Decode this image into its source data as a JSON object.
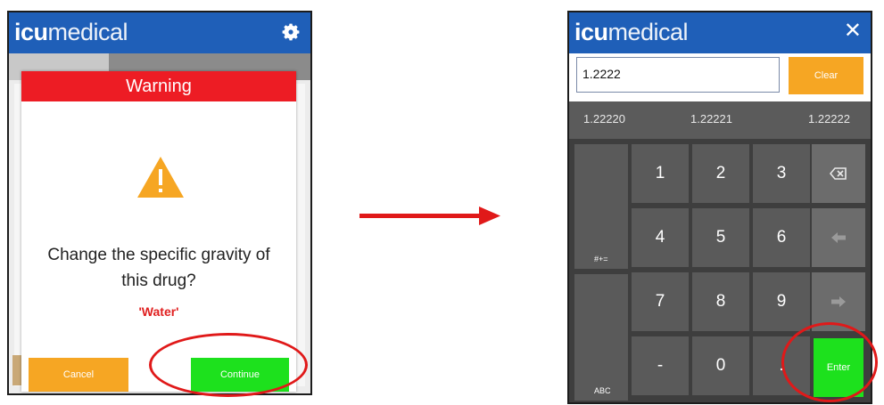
{
  "left_screen": {
    "logo_bold": "icu",
    "logo_light": "medical",
    "dialog": {
      "title": "Warning",
      "message_line1": "Change the specific gravity of",
      "message_line2": "this drug?",
      "drug_name": "'Water'",
      "cancel_label": "Cancel",
      "continue_label": "Continue"
    },
    "icons": {
      "settings": "gear-icon",
      "warning": "warning-triangle-icon"
    }
  },
  "arrow_icon": "right-arrow-icon",
  "right_screen": {
    "logo_bold": "icu",
    "logo_light": "medical",
    "close_glyph": "✕",
    "input_value": "1.2222",
    "clear_label": "Clear",
    "suggestions": [
      "1.22220",
      "1.22221",
      "1.22222"
    ],
    "keys": {
      "row1": [
        "1",
        "2",
        "3"
      ],
      "row2": [
        "4",
        "5",
        "6"
      ],
      "row3": [
        "7",
        "8",
        "9"
      ],
      "row4": [
        "-",
        "0",
        "."
      ]
    },
    "symbols_key_label": "#+=",
    "abc_key_label": "ABC",
    "enter_label": "Enter",
    "icons": {
      "backspace": "backspace-icon",
      "left": "arrow-left-icon",
      "right": "arrow-right-icon"
    }
  },
  "colors": {
    "appbar": "#1f5fb8",
    "warning_header": "#ed1c24",
    "cancel": "#f6a623",
    "continue": "#1de11d",
    "highlight": "#e01919",
    "warning_icon": "#f6a623"
  }
}
